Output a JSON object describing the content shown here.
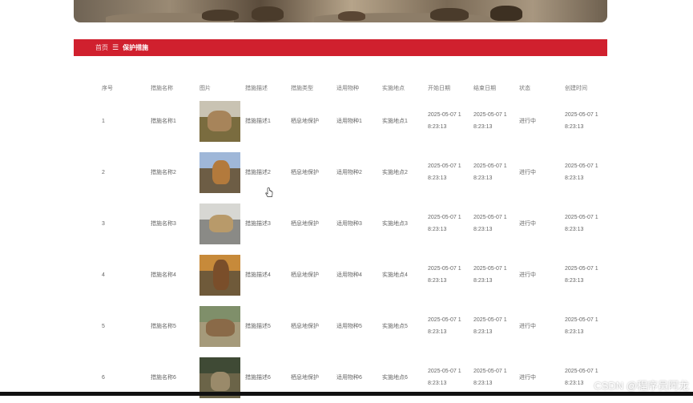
{
  "breadcrumb": {
    "home": "首页",
    "separator": "☰",
    "current": "保护措施"
  },
  "colors": {
    "accent": "#d0202e",
    "text": "#666666",
    "background": "#ffffff"
  },
  "table": {
    "headers": [
      "序号",
      "措施名称",
      "图片",
      "措施描述",
      "措施类型",
      "适用物种",
      "实施地点",
      "开始日期",
      "结束日期",
      "状态",
      "创建时间"
    ],
    "rows": [
      {
        "index": "1",
        "name": "措施名称1",
        "image": "lion-photo",
        "desc": "措施描述1",
        "type": "栖息地保护",
        "species": "适用物种1",
        "place": "实施地点1",
        "start_a": "2025-05-07 1",
        "start_b": "8:23:13",
        "end_a": "2025-05-07 1",
        "end_b": "8:23:13",
        "status": "进行中",
        "created_a": "2025-05-07 1",
        "created_b": "8:23:13"
      },
      {
        "index": "2",
        "name": "措施名称2",
        "image": "horse-photo",
        "desc": "措施描述2",
        "type": "栖息地保护",
        "species": "适用物种2",
        "place": "实施地点2",
        "start_a": "2025-05-07 1",
        "start_b": "8:23:13",
        "end_a": "2025-05-07 1",
        "end_b": "8:23:13",
        "status": "进行中",
        "created_a": "2025-05-07 1",
        "created_b": "8:23:13"
      },
      {
        "index": "3",
        "name": "措施名称3",
        "image": "leopard-photo",
        "desc": "措施描述3",
        "type": "栖息地保护",
        "species": "适用物种3",
        "place": "实施地点3",
        "start_a": "2025-05-07 1",
        "start_b": "8:23:13",
        "end_a": "2025-05-07 1",
        "end_b": "8:23:13",
        "status": "进行中",
        "created_a": "2025-05-07 1",
        "created_b": "8:23:13"
      },
      {
        "index": "4",
        "name": "措施名称4",
        "image": "bear-photo",
        "desc": "措施描述4",
        "type": "栖息地保护",
        "species": "适用物种4",
        "place": "实施地点4",
        "start_a": "2025-05-07 1",
        "start_b": "8:23:13",
        "end_a": "2025-05-07 1",
        "end_b": "8:23:13",
        "status": "进行中",
        "created_a": "2025-05-07 1",
        "created_b": "8:23:13"
      },
      {
        "index": "5",
        "name": "措施名称5",
        "image": "deer-photo",
        "desc": "措施描述5",
        "type": "栖息地保护",
        "species": "适用物种5",
        "place": "实施地点5",
        "start_a": "2025-05-07 1",
        "start_b": "8:23:13",
        "end_a": "2025-05-07 1",
        "end_b": "8:23:13",
        "status": "进行中",
        "created_a": "2025-05-07 1",
        "created_b": "8:23:13"
      },
      {
        "index": "6",
        "name": "措施名称6",
        "image": "bird-photo",
        "desc": "措施描述6",
        "type": "栖息地保护",
        "species": "适用物种6",
        "place": "实施地点6",
        "start_a": "2025-05-07 1",
        "start_b": "8:23:13",
        "end_a": "2025-05-07 1",
        "end_b": "8:23:13",
        "status": "进行中",
        "created_a": "2025-05-07 1",
        "created_b": "8:23:13"
      }
    ]
  },
  "watermark": "CSDN @程序员阿龙"
}
